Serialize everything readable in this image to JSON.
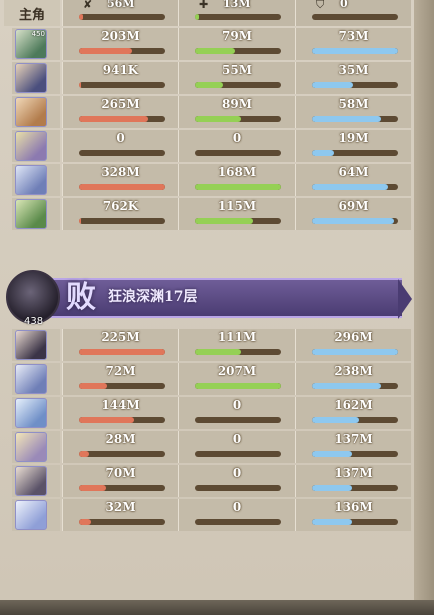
{
  "team_label": "主角",
  "header": {
    "values": [
      "56M",
      "13M",
      "0"
    ],
    "icons": [
      "✘",
      "✚",
      "⛉"
    ],
    "fills": [
      0.05,
      0.05,
      0.0
    ]
  },
  "colors": {
    "damage": "#e0765a",
    "heal": "#95d055",
    "defense": "#8ec8ef"
  },
  "team1": [
    {
      "level": "450",
      "damage": "203M",
      "heal": "79M",
      "defense": "73M",
      "fills": [
        0.62,
        0.47,
        1.0
      ]
    },
    {
      "level": "",
      "damage": "941K",
      "heal": "55M",
      "defense": "35M",
      "fills": [
        0.02,
        0.33,
        0.48
      ]
    },
    {
      "level": "",
      "damage": "265M",
      "heal": "89M",
      "defense": "58M",
      "fills": [
        0.8,
        0.53,
        0.8
      ]
    },
    {
      "level": "",
      "damage": "0",
      "heal": "0",
      "defense": "19M",
      "fills": [
        0.0,
        0.0,
        0.26
      ]
    },
    {
      "level": "",
      "damage": "328M",
      "heal": "168M",
      "defense": "64M",
      "fills": [
        1.0,
        1.0,
        0.88
      ]
    },
    {
      "level": "",
      "damage": "762K",
      "heal": "115M",
      "defense": "69M",
      "fills": [
        0.02,
        0.68,
        0.95
      ]
    }
  ],
  "banner": {
    "result": "败",
    "stage": "狂浪深渊17层",
    "boss_level": "438"
  },
  "team2": [
    {
      "level": "",
      "damage": "225M",
      "heal": "111M",
      "defense": "296M",
      "fills": [
        1.0,
        0.54,
        1.0
      ]
    },
    {
      "level": "",
      "damage": "72M",
      "heal": "207M",
      "defense": "238M",
      "fills": [
        0.32,
        1.0,
        0.8
      ]
    },
    {
      "level": "",
      "damage": "144M",
      "heal": "0",
      "defense": "162M",
      "fills": [
        0.64,
        0.0,
        0.55
      ]
    },
    {
      "level": "",
      "damage": "28M",
      "heal": "0",
      "defense": "137M",
      "fills": [
        0.12,
        0.0,
        0.46
      ]
    },
    {
      "level": "",
      "damage": "70M",
      "heal": "0",
      "defense": "137M",
      "fills": [
        0.31,
        0.0,
        0.46
      ]
    },
    {
      "level": "",
      "damage": "32M",
      "heal": "0",
      "defense": "136M",
      "fills": [
        0.14,
        0.0,
        0.46
      ]
    }
  ]
}
